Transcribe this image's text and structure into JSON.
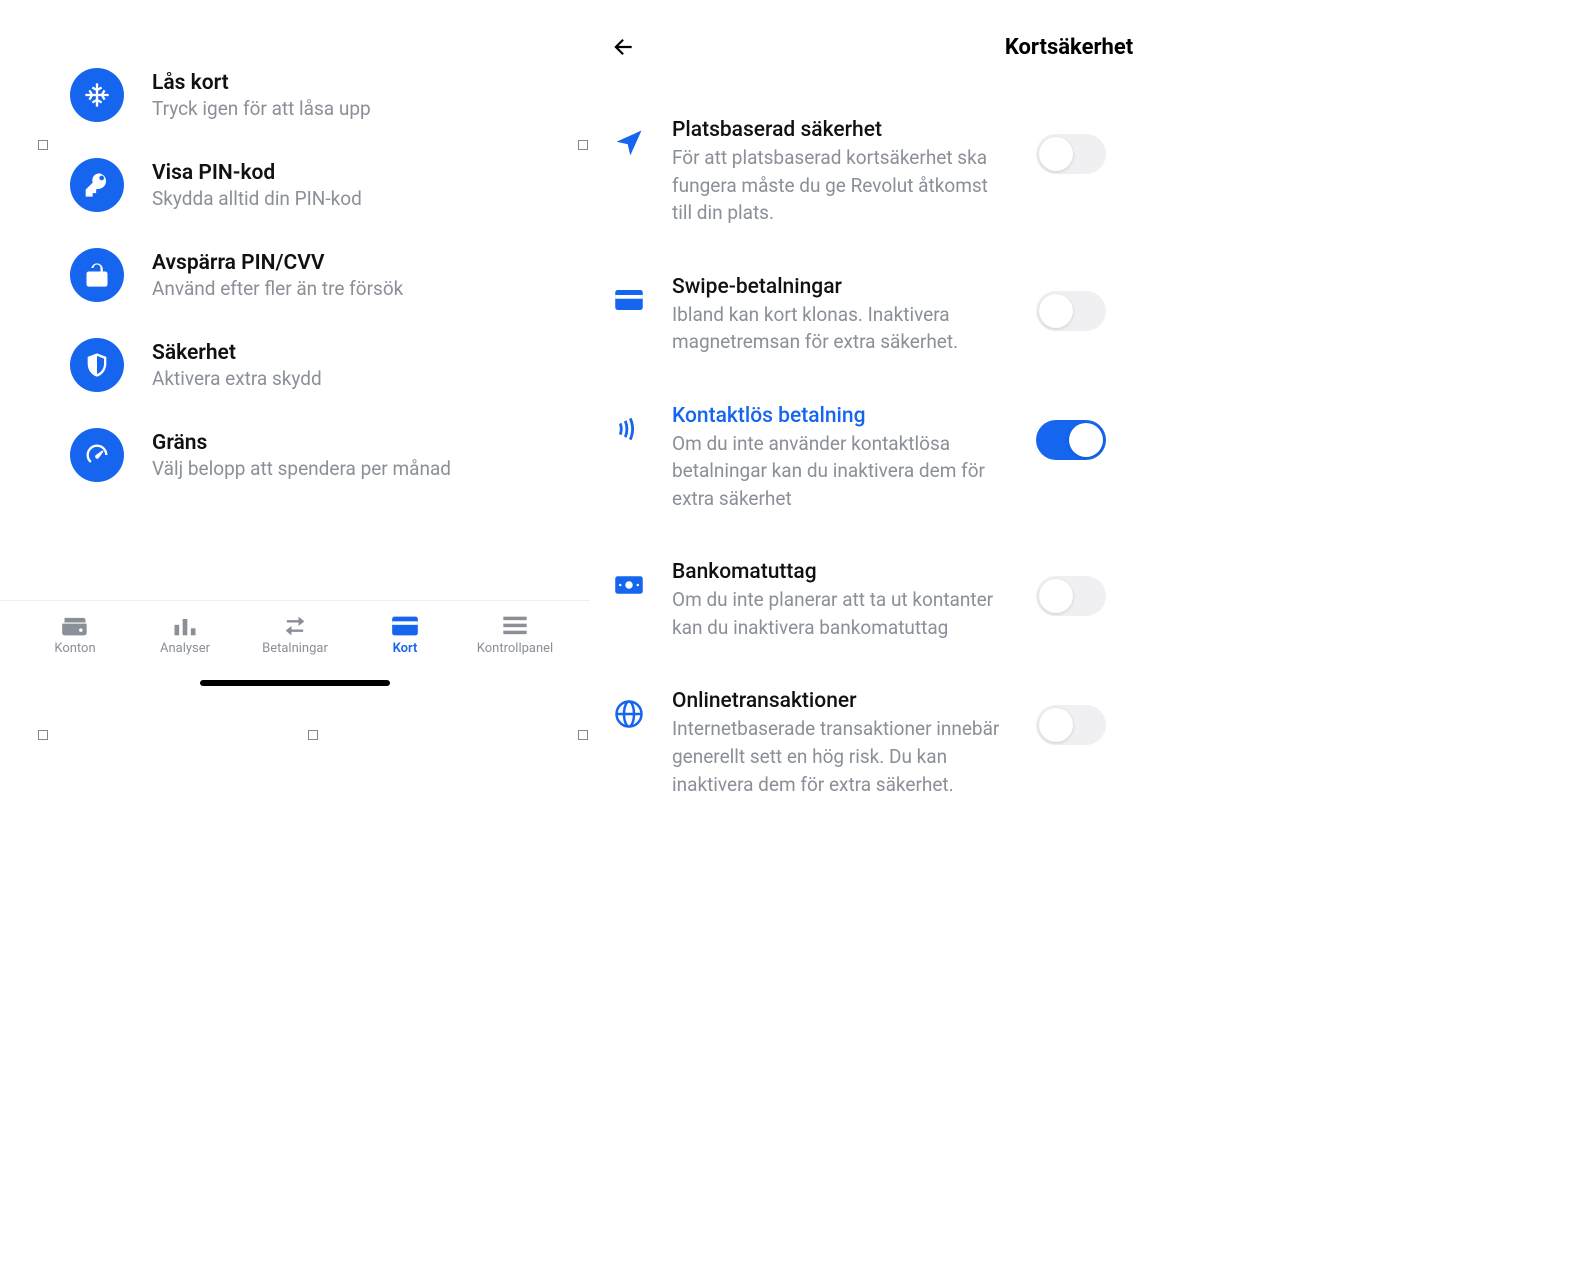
{
  "left": {
    "items": [
      {
        "title": "Lås kort",
        "sub": "Tryck igen för att låsa upp",
        "icon": "snowflake"
      },
      {
        "title": "Visa PIN-kod",
        "sub": "Skydda alltid din PIN-kod",
        "icon": "key"
      },
      {
        "title": "Avspärra PIN/CVV",
        "sub": "Använd efter fler än tre försök",
        "icon": "unlock"
      },
      {
        "title": "Säkerhet",
        "sub": "Aktivera extra skydd",
        "icon": "shield"
      },
      {
        "title": "Gräns",
        "sub": "Välj belopp att spendera per månad",
        "icon": "gauge"
      }
    ],
    "tabs": [
      {
        "label": "Konton",
        "icon": "wallet"
      },
      {
        "label": "Analyser",
        "icon": "bars"
      },
      {
        "label": "Betalningar",
        "icon": "transfer"
      },
      {
        "label": "Kort",
        "icon": "card",
        "active": true
      },
      {
        "label": "Kontrollpanel",
        "icon": "stack"
      }
    ]
  },
  "right": {
    "title": "Kortsäkerhet",
    "settings": [
      {
        "key": "location",
        "title": "Platsbaserad säkerhet",
        "sub": "För att platsbaserad kortsäkerhet ska fungera måste du ge Revolut åtkomst till din plats.",
        "icon": "location",
        "on": false
      },
      {
        "key": "swipe",
        "title": "Swipe-betalningar",
        "sub": "Ibland kan kort klonas. Inaktivera magnetremsan för extra säkerhet.",
        "icon": "card",
        "on": false
      },
      {
        "key": "contactless",
        "title": "Kontaktlös betalning",
        "sub": "Om du inte använder kontaktlösa betalningar kan du inaktivera dem för extra säkerhet",
        "icon": "contactless",
        "on": true,
        "accent": true
      },
      {
        "key": "atm",
        "title": "Bankomatuttag",
        "sub": "Om du inte planerar att ta ut kontanter kan du inaktivera bankomatuttag",
        "icon": "cash",
        "on": false
      },
      {
        "key": "online",
        "title": "Onlinetransaktioner",
        "sub": "Internetbaserade transaktioner innebär generellt sett en hög risk. Du kan inaktivera dem för extra säkerhet.",
        "icon": "globe",
        "on": false
      }
    ]
  }
}
